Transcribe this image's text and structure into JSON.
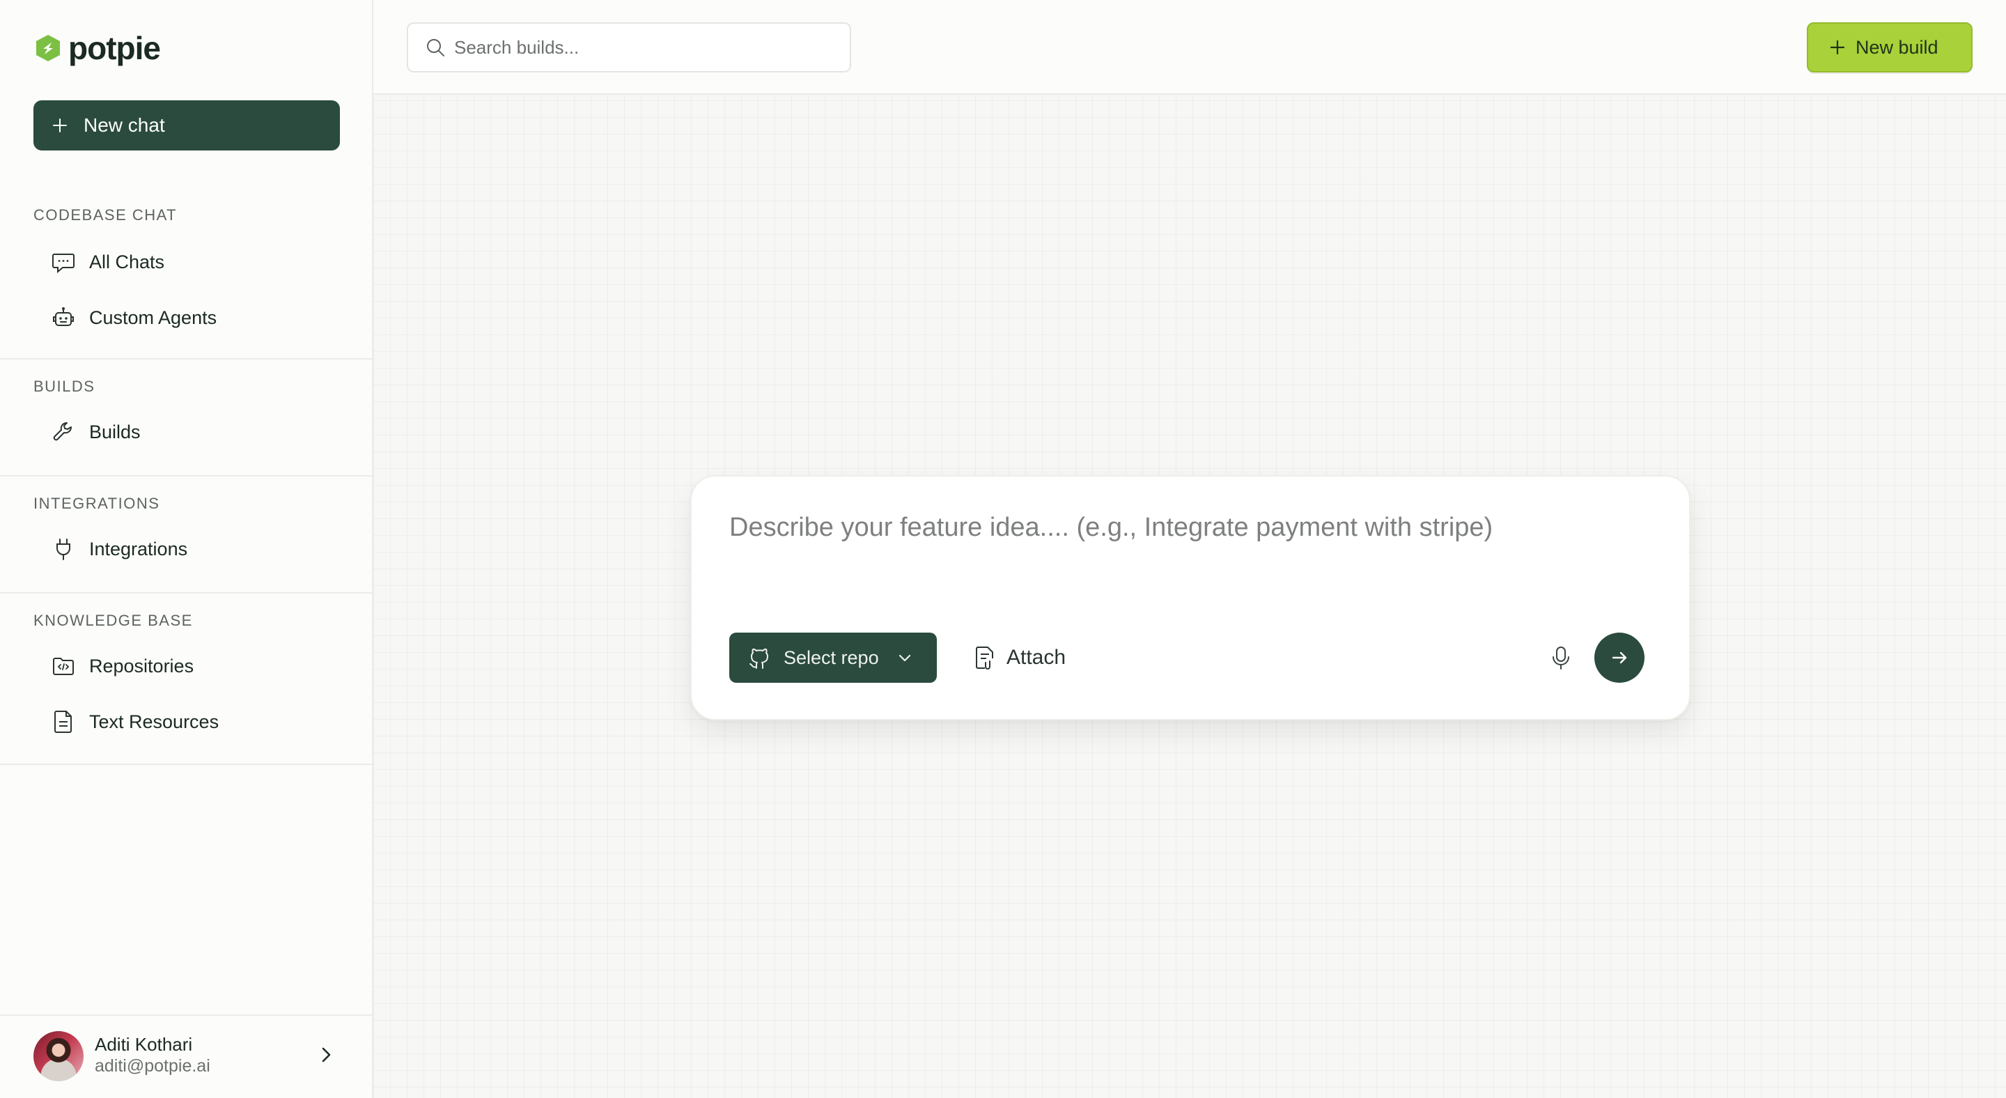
{
  "brand": {
    "name": "potpie",
    "accent": "#2a4b3d",
    "logo_green": "#7bc043"
  },
  "sidebar": {
    "new_chat_label": "New chat",
    "sections": [
      {
        "title": "CODEBASE CHAT",
        "items": [
          {
            "label": "All Chats",
            "icon": "chat-bubble-icon"
          },
          {
            "label": "Custom Agents",
            "icon": "robot-icon"
          }
        ]
      },
      {
        "title": "BUILDS",
        "items": [
          {
            "label": "Builds",
            "icon": "wrench-icon"
          }
        ]
      },
      {
        "title": "INTEGRATIONS",
        "items": [
          {
            "label": "Integrations",
            "icon": "plug-icon"
          }
        ]
      },
      {
        "title": "KNOWLEDGE BASE",
        "items": [
          {
            "label": "Repositories",
            "icon": "code-folder-icon"
          },
          {
            "label": "Text Resources",
            "icon": "document-icon"
          }
        ]
      }
    ],
    "user": {
      "name": "Aditi Kothari",
      "email": "aditi@potpie.ai"
    }
  },
  "topbar": {
    "search_placeholder": "Search builds...",
    "new_build_label": "New build",
    "new_build_color": "#a8d13a"
  },
  "composer": {
    "placeholder": "Describe your feature idea.... (e.g., Integrate payment with stripe)",
    "select_repo_label": "Select repo",
    "attach_label": "Attach"
  }
}
